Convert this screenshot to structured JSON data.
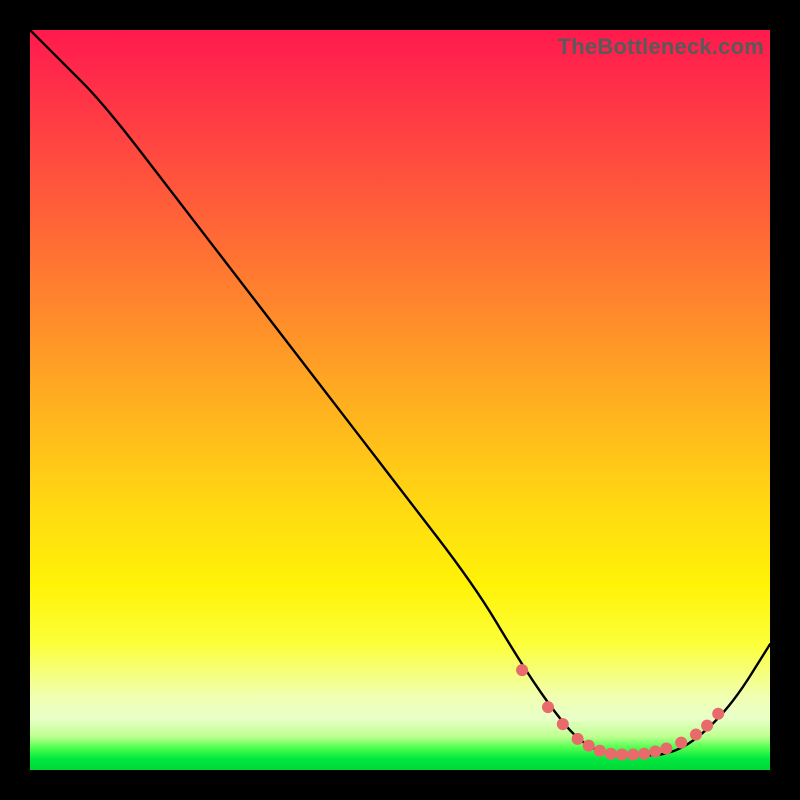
{
  "watermark": "TheBottleneck.com",
  "chart_data": {
    "type": "line",
    "title": "",
    "xlabel": "",
    "ylabel": "",
    "xlim": [
      0,
      100
    ],
    "ylim": [
      0,
      100
    ],
    "series": [
      {
        "name": "curve",
        "x": [
          0,
          4,
          10,
          20,
          30,
          40,
          50,
          60,
          66,
          70,
          74,
          78,
          82,
          86,
          90,
          95,
          100
        ],
        "y": [
          100,
          96,
          90,
          77,
          64,
          51,
          38,
          25,
          15,
          9,
          4,
          2,
          2,
          2,
          4,
          9,
          17
        ]
      }
    ],
    "markers": {
      "name": "dots",
      "x": [
        66.5,
        70,
        72,
        74,
        75.5,
        77,
        78.5,
        80,
        81.5,
        83,
        84.5,
        86,
        88,
        90,
        91.5,
        93
      ],
      "y": [
        13.5,
        8.5,
        6.2,
        4.2,
        3.3,
        2.6,
        2.2,
        2.1,
        2.1,
        2.2,
        2.5,
        2.9,
        3.7,
        4.8,
        6.0,
        7.6
      ],
      "color": "#e86a6a",
      "radius_px": 6
    },
    "gradient_stops": [
      {
        "pos": 0.0,
        "color": "#ff1a4d"
      },
      {
        "pos": 0.5,
        "color": "#ffc018"
      },
      {
        "pos": 0.8,
        "color": "#fdff30"
      },
      {
        "pos": 0.97,
        "color": "#4eff4e"
      },
      {
        "pos": 1.0,
        "color": "#00d838"
      }
    ]
  }
}
